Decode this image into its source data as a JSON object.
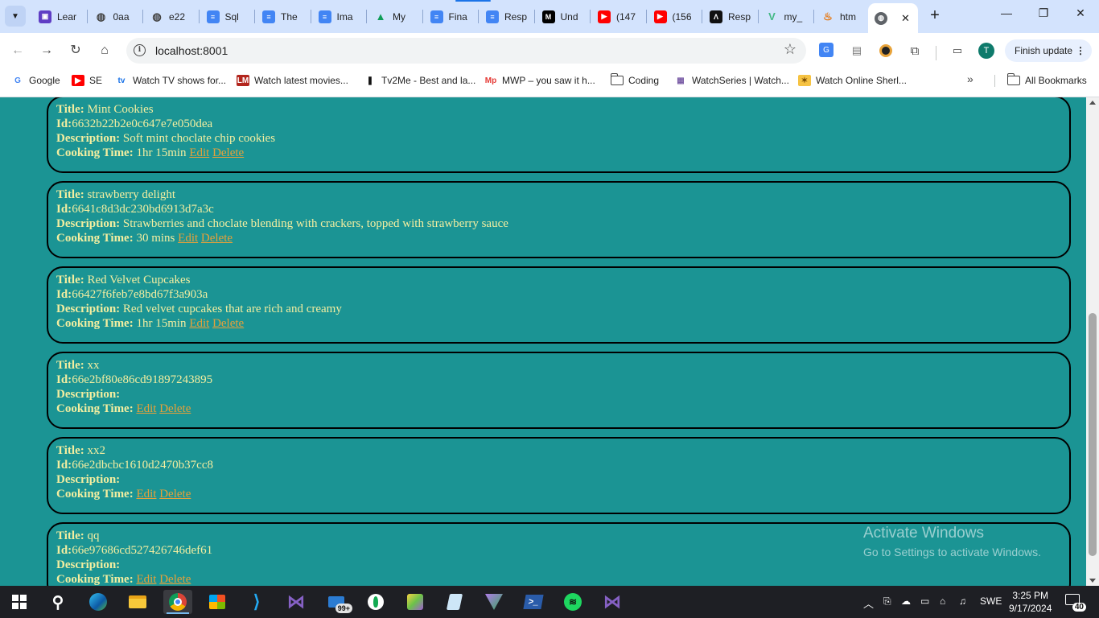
{
  "browser": {
    "tabs": [
      {
        "title": "Lear",
        "icon": "generic-purple",
        "color": "#5f3dc4"
      },
      {
        "title": "0aa",
        "icon": "globe",
        "color": "#444444"
      },
      {
        "title": "e22",
        "icon": "globe",
        "color": "#444444"
      },
      {
        "title": "Sql",
        "icon": "docs",
        "color": "#4285f4"
      },
      {
        "title": "The",
        "icon": "docs",
        "color": "#4285f4"
      },
      {
        "title": "Ima",
        "icon": "docs",
        "color": "#4285f4"
      },
      {
        "title": "My",
        "icon": "drive",
        "color": "#0f9d58"
      },
      {
        "title": "Fina",
        "icon": "docs",
        "color": "#4285f4"
      },
      {
        "title": "Resp",
        "icon": "docs",
        "color": "#4285f4"
      },
      {
        "title": "Und",
        "icon": "medium",
        "color": "#000000"
      },
      {
        "title": "(147",
        "icon": "youtube",
        "color": "#ff0000"
      },
      {
        "title": "(156",
        "icon": "youtube",
        "color": "#ff0000"
      },
      {
        "title": "Resp",
        "icon": "nextjs",
        "color": "#111111"
      },
      {
        "title": "my_",
        "icon": "vue",
        "color": "#41b883"
      },
      {
        "title": "htm",
        "icon": "java",
        "color": "#e76f00"
      }
    ],
    "active_tab_close": "✕",
    "new_tab": "+",
    "window_controls": {
      "minimize": "—",
      "maximize": "❐",
      "close": "✕"
    },
    "url": "localhost:8001",
    "finish_update": "Finish update",
    "profile_initial": "T",
    "bookmarks": [
      {
        "label": "Google",
        "icon": "google"
      },
      {
        "label": "SE",
        "icon": "youtube"
      },
      {
        "label": "Watch TV shows for...",
        "icon": "tv"
      },
      {
        "label": "Watch latest movies...",
        "icon": "movies"
      },
      {
        "label": "Tv2Me - Best and la...",
        "icon": "tv2me"
      },
      {
        "label": "MWP – you saw it h...",
        "icon": "mwp"
      },
      {
        "label": "Coding",
        "icon": "folder"
      },
      {
        "label": "WatchSeries | Watch...",
        "icon": "watchseries"
      },
      {
        "label": "Watch Online Sherl...",
        "icon": "sherlock"
      }
    ],
    "bookmarks_more": "»",
    "all_bookmarks": "All Bookmarks"
  },
  "recipes": [
    {
      "title": "Mint Cookies",
      "id": "6632b22b2e0c647e7e050dea",
      "description": "Soft mint choclate chip cookies",
      "cooking_time": "1hr 15min"
    },
    {
      "title": "strawberry delight",
      "id": "6641c8d3dc230bd6913d7a3c",
      "description": "Strawberries and choclate blending with crackers, topped with strawberry sauce",
      "cooking_time": "30 mins"
    },
    {
      "title": "Red Velvet Cupcakes",
      "id": "66427f6feb7e8bd67f3a903a",
      "description": "Red velvet cupcakes that are rich and creamy",
      "cooking_time": "1hr 15min"
    },
    {
      "title": "xx",
      "id": "66e2bf80e86cd91897243895",
      "description": "",
      "cooking_time": ""
    },
    {
      "title": "xx2",
      "id": "66e2dbcbc1610d2470b37cc8",
      "description": "",
      "cooking_time": ""
    },
    {
      "title": "qq",
      "id": "66e97686cd527426746def61",
      "description": "",
      "cooking_time": ""
    }
  ],
  "labels": {
    "title": "Title:",
    "id": "Id:",
    "description": "Description:",
    "cooking_time": "Cooking Time:",
    "edit": "Edit",
    "delete": "Delete"
  },
  "watermark": {
    "line1": "Activate Windows",
    "line2": "Go to Settings to activate Windows."
  },
  "taskbar": {
    "apps": [
      "start",
      "search",
      "edge",
      "file-explorer",
      "chrome",
      "microsoft-store",
      "vscode",
      "visual-studio",
      "mail",
      "mongodb-compass",
      "paint",
      "notepad",
      "postman",
      "powershell",
      "spotify",
      "visual-studio-2"
    ],
    "mail_badge": "99+",
    "language": "SWE",
    "time": "3:25 PM",
    "date": "9/17/2024",
    "notifications": "40"
  },
  "colors": {
    "page_background": "#1b9494",
    "card_text": "#f3eea0",
    "link": "#e6a13a"
  }
}
